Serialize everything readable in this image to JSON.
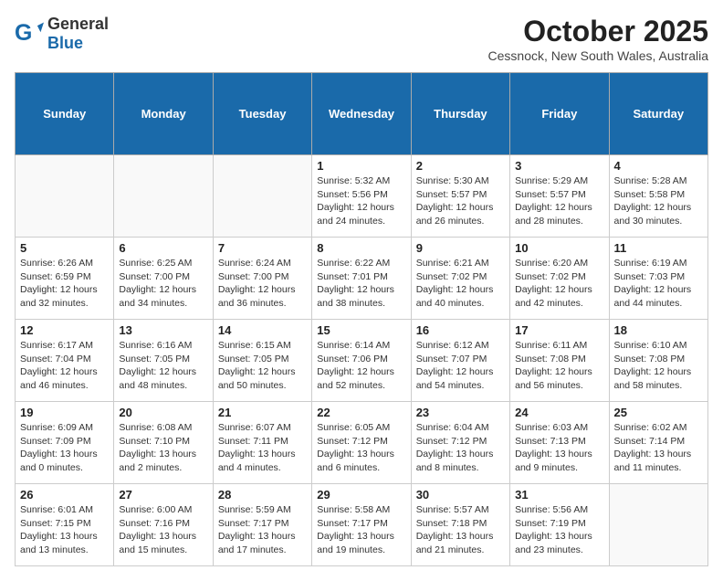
{
  "header": {
    "logo_general": "General",
    "logo_blue": "Blue",
    "title": "October 2025",
    "location": "Cessnock, New South Wales, Australia"
  },
  "columns": [
    "Sunday",
    "Monday",
    "Tuesday",
    "Wednesday",
    "Thursday",
    "Friday",
    "Saturday"
  ],
  "weeks": [
    [
      {
        "day": "",
        "info": ""
      },
      {
        "day": "",
        "info": ""
      },
      {
        "day": "",
        "info": ""
      },
      {
        "day": "1",
        "info": "Sunrise: 5:32 AM\nSunset: 5:56 PM\nDaylight: 12 hours\nand 24 minutes."
      },
      {
        "day": "2",
        "info": "Sunrise: 5:30 AM\nSunset: 5:57 PM\nDaylight: 12 hours\nand 26 minutes."
      },
      {
        "day": "3",
        "info": "Sunrise: 5:29 AM\nSunset: 5:57 PM\nDaylight: 12 hours\nand 28 minutes."
      },
      {
        "day": "4",
        "info": "Sunrise: 5:28 AM\nSunset: 5:58 PM\nDaylight: 12 hours\nand 30 minutes."
      }
    ],
    [
      {
        "day": "5",
        "info": "Sunrise: 6:26 AM\nSunset: 6:59 PM\nDaylight: 12 hours\nand 32 minutes."
      },
      {
        "day": "6",
        "info": "Sunrise: 6:25 AM\nSunset: 7:00 PM\nDaylight: 12 hours\nand 34 minutes."
      },
      {
        "day": "7",
        "info": "Sunrise: 6:24 AM\nSunset: 7:00 PM\nDaylight: 12 hours\nand 36 minutes."
      },
      {
        "day": "8",
        "info": "Sunrise: 6:22 AM\nSunset: 7:01 PM\nDaylight: 12 hours\nand 38 minutes."
      },
      {
        "day": "9",
        "info": "Sunrise: 6:21 AM\nSunset: 7:02 PM\nDaylight: 12 hours\nand 40 minutes."
      },
      {
        "day": "10",
        "info": "Sunrise: 6:20 AM\nSunset: 7:02 PM\nDaylight: 12 hours\nand 42 minutes."
      },
      {
        "day": "11",
        "info": "Sunrise: 6:19 AM\nSunset: 7:03 PM\nDaylight: 12 hours\nand 44 minutes."
      }
    ],
    [
      {
        "day": "12",
        "info": "Sunrise: 6:17 AM\nSunset: 7:04 PM\nDaylight: 12 hours\nand 46 minutes."
      },
      {
        "day": "13",
        "info": "Sunrise: 6:16 AM\nSunset: 7:05 PM\nDaylight: 12 hours\nand 48 minutes."
      },
      {
        "day": "14",
        "info": "Sunrise: 6:15 AM\nSunset: 7:05 PM\nDaylight: 12 hours\nand 50 minutes."
      },
      {
        "day": "15",
        "info": "Sunrise: 6:14 AM\nSunset: 7:06 PM\nDaylight: 12 hours\nand 52 minutes."
      },
      {
        "day": "16",
        "info": "Sunrise: 6:12 AM\nSunset: 7:07 PM\nDaylight: 12 hours\nand 54 minutes."
      },
      {
        "day": "17",
        "info": "Sunrise: 6:11 AM\nSunset: 7:08 PM\nDaylight: 12 hours\nand 56 minutes."
      },
      {
        "day": "18",
        "info": "Sunrise: 6:10 AM\nSunset: 7:08 PM\nDaylight: 12 hours\nand 58 minutes."
      }
    ],
    [
      {
        "day": "19",
        "info": "Sunrise: 6:09 AM\nSunset: 7:09 PM\nDaylight: 13 hours\nand 0 minutes."
      },
      {
        "day": "20",
        "info": "Sunrise: 6:08 AM\nSunset: 7:10 PM\nDaylight: 13 hours\nand 2 minutes."
      },
      {
        "day": "21",
        "info": "Sunrise: 6:07 AM\nSunset: 7:11 PM\nDaylight: 13 hours\nand 4 minutes."
      },
      {
        "day": "22",
        "info": "Sunrise: 6:05 AM\nSunset: 7:12 PM\nDaylight: 13 hours\nand 6 minutes."
      },
      {
        "day": "23",
        "info": "Sunrise: 6:04 AM\nSunset: 7:12 PM\nDaylight: 13 hours\nand 8 minutes."
      },
      {
        "day": "24",
        "info": "Sunrise: 6:03 AM\nSunset: 7:13 PM\nDaylight: 13 hours\nand 9 minutes."
      },
      {
        "day": "25",
        "info": "Sunrise: 6:02 AM\nSunset: 7:14 PM\nDaylight: 13 hours\nand 11 minutes."
      }
    ],
    [
      {
        "day": "26",
        "info": "Sunrise: 6:01 AM\nSunset: 7:15 PM\nDaylight: 13 hours\nand 13 minutes."
      },
      {
        "day": "27",
        "info": "Sunrise: 6:00 AM\nSunset: 7:16 PM\nDaylight: 13 hours\nand 15 minutes."
      },
      {
        "day": "28",
        "info": "Sunrise: 5:59 AM\nSunset: 7:17 PM\nDaylight: 13 hours\nand 17 minutes."
      },
      {
        "day": "29",
        "info": "Sunrise: 5:58 AM\nSunset: 7:17 PM\nDaylight: 13 hours\nand 19 minutes."
      },
      {
        "day": "30",
        "info": "Sunrise: 5:57 AM\nSunset: 7:18 PM\nDaylight: 13 hours\nand 21 minutes."
      },
      {
        "day": "31",
        "info": "Sunrise: 5:56 AM\nSunset: 7:19 PM\nDaylight: 13 hours\nand 23 minutes."
      },
      {
        "day": "",
        "info": ""
      }
    ]
  ]
}
